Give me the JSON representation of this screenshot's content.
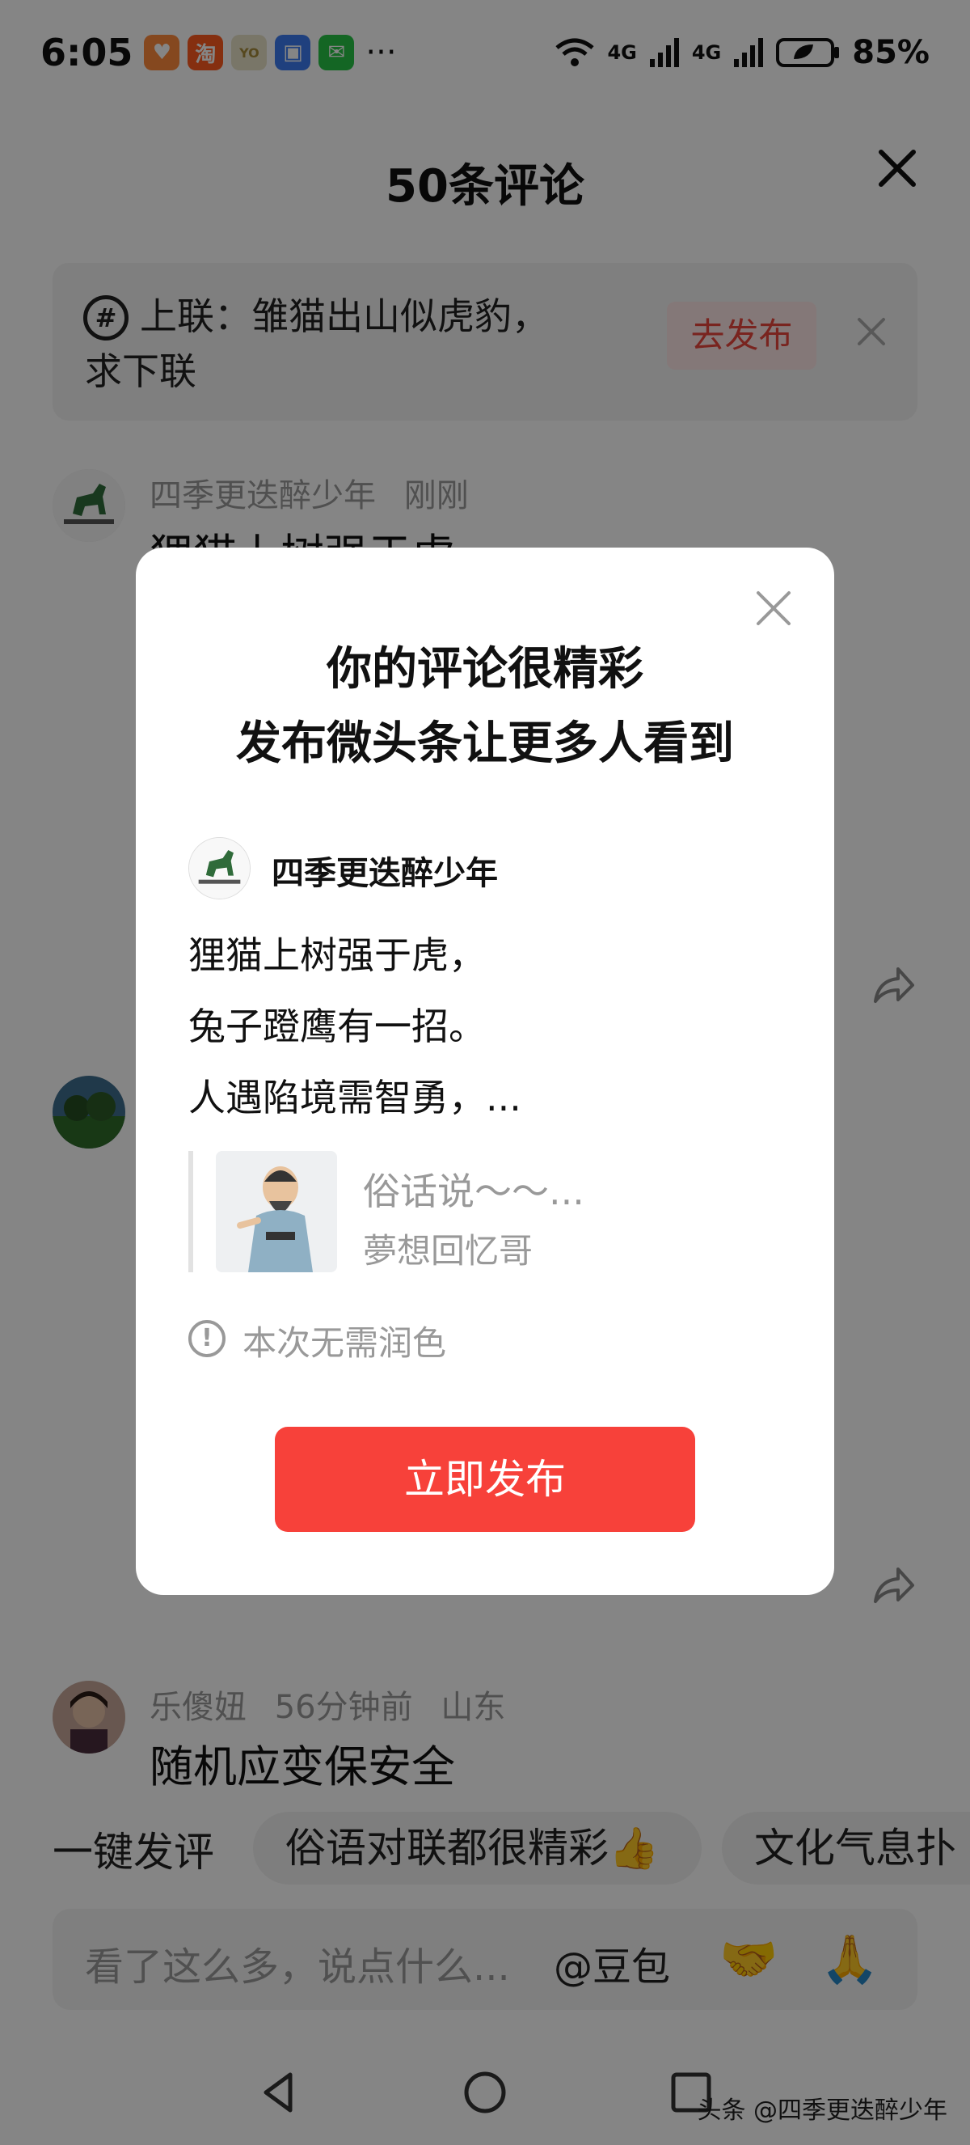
{
  "status_bar": {
    "time": "6:05",
    "network_1": "4G",
    "network_2": "4G",
    "battery": "85%"
  },
  "sheet": {
    "title": "50条评论"
  },
  "prompt": {
    "text": "上联：雏猫出山似虎豹，求下联",
    "button": "去发布"
  },
  "comments": [
    {
      "author": "四季更迭醉少年",
      "time": "刚刚",
      "location": "",
      "body": "狸猫上树强于虎"
    },
    {
      "author": "乐傻妞",
      "time": "56分钟前",
      "location": "山东",
      "body": "随机应变保安全"
    }
  ],
  "quick_reply": {
    "label": "一键发评",
    "chips": [
      "俗语对联都很精彩👍",
      "文化气息扑"
    ]
  },
  "input": {
    "placeholder": "看了这么多，说点什么...",
    "mention": "@豆包",
    "emoji_1": "🤝",
    "emoji_2": "🙏"
  },
  "watermark": "头条 @四季更迭醉少年",
  "modal": {
    "title_line1": "你的评论很精彩",
    "title_line2": "发布微头条让更多人看到",
    "username": "四季更迭醉少年",
    "lines": [
      "狸猫上树强于虎，",
      "兔子蹬鹰有一招。",
      "人遇陷境需智勇，..."
    ],
    "quote_title": "俗话说～～...",
    "quote_author": "夢想回忆哥",
    "note": "本次无需润色",
    "publish_button": "立即发布"
  },
  "colors": {
    "accent": "#f7413a",
    "accent_light": "#fde6e6"
  }
}
